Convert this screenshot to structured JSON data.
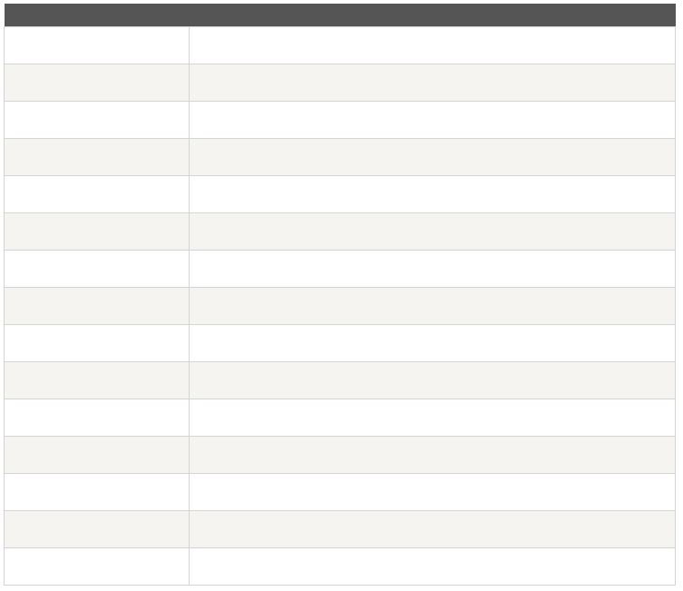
{
  "table": {
    "headers": {
      "function": "",
      "description": ""
    },
    "rows": [
      {
        "function": "",
        "description": ""
      },
      {
        "function": "",
        "description": ""
      },
      {
        "function": "",
        "description": ""
      },
      {
        "function": "",
        "description": ""
      },
      {
        "function": "",
        "description": ""
      },
      {
        "function": "",
        "description": ""
      },
      {
        "function": "",
        "description": ""
      },
      {
        "function": "",
        "description": ""
      },
      {
        "function": "",
        "description": ""
      },
      {
        "function": "",
        "description": ""
      },
      {
        "function": "",
        "description": ""
      },
      {
        "function": "",
        "description": ""
      },
      {
        "function": "",
        "description": ""
      },
      {
        "function": "",
        "description": ""
      },
      {
        "function": "",
        "description": ""
      }
    ]
  },
  "colors": {
    "header_bg": "#555555",
    "link": "#2f6e20",
    "row_alt": "#f6f4f0",
    "border": "#d4d4d4"
  }
}
